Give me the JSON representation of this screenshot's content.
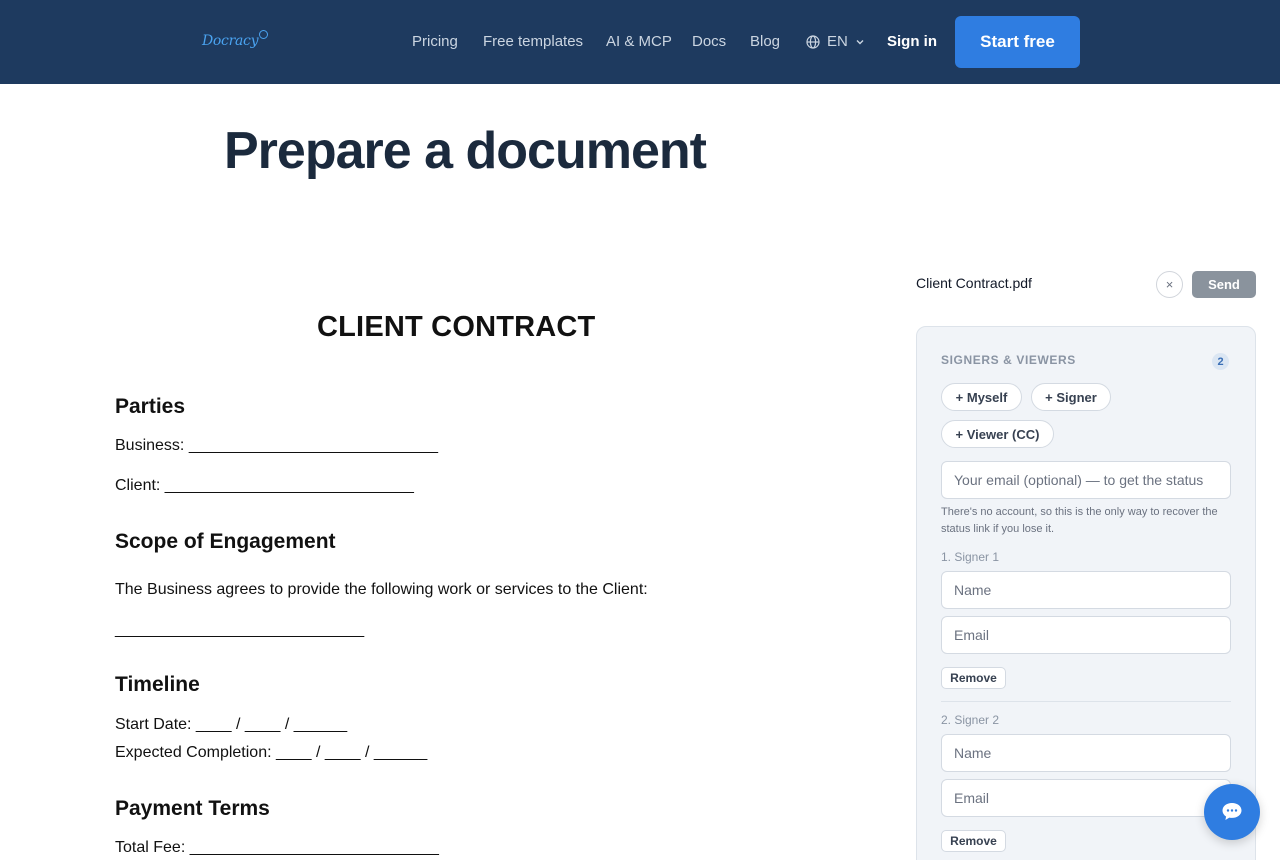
{
  "header": {
    "logo_text": "Docracy",
    "nav": [
      {
        "label": "Pricing"
      },
      {
        "label": "Free templates"
      },
      {
        "label": "AI & MCP"
      },
      {
        "label": "Docs"
      },
      {
        "label": "Blog"
      }
    ],
    "language": "EN",
    "sign_in": "Sign in",
    "start_free": "Start free"
  },
  "page_title": "Prepare a document",
  "document": {
    "title": "CLIENT CONTRACT",
    "parties_heading": "Parties",
    "business_line": "Business: ____________________________",
    "client_line": "Client: ____________________________",
    "scope_heading": "Scope of Engagement",
    "scope_text": "The Business agrees to provide the following work or services to the Client:",
    "scope_blank": "____________________________",
    "timeline_heading": "Timeline",
    "start_date": "Start Date: ____ / ____ / ______",
    "expected_completion": "Expected Completion: ____ / ____ / ______",
    "payment_heading": "Payment Terms",
    "total_fee": "Total Fee: ____________________________"
  },
  "sidebar": {
    "file_name": "Client Contract.pdf",
    "close_label": "×",
    "send_label": "Send",
    "section_title": "SIGNERS & VIEWERS",
    "count": "2",
    "add_myself": "+ Myself",
    "add_signer": "+ Signer",
    "add_viewer": "+ Viewer (CC)",
    "email_placeholder": "Your email (optional) — to get the status",
    "email_helper": "There's no account, so this is the only way to recover the status link if you lose it.",
    "signers": [
      {
        "label": "1. Signer 1",
        "name_placeholder": "Name",
        "email_placeholder": "Email",
        "remove": "Remove"
      },
      {
        "label": "2. Signer 2",
        "name_placeholder": "Name",
        "email_placeholder": "Email",
        "remove": "Remove"
      }
    ]
  },
  "colors": {
    "header_bg": "#1e3a5f",
    "accent": "#2f7de1",
    "send_disabled": "#8a939d",
    "panel_bg": "#f1f4f8"
  },
  "icons": [
    "globe-icon",
    "chevron-down-icon",
    "close-icon",
    "chat-icon"
  ]
}
